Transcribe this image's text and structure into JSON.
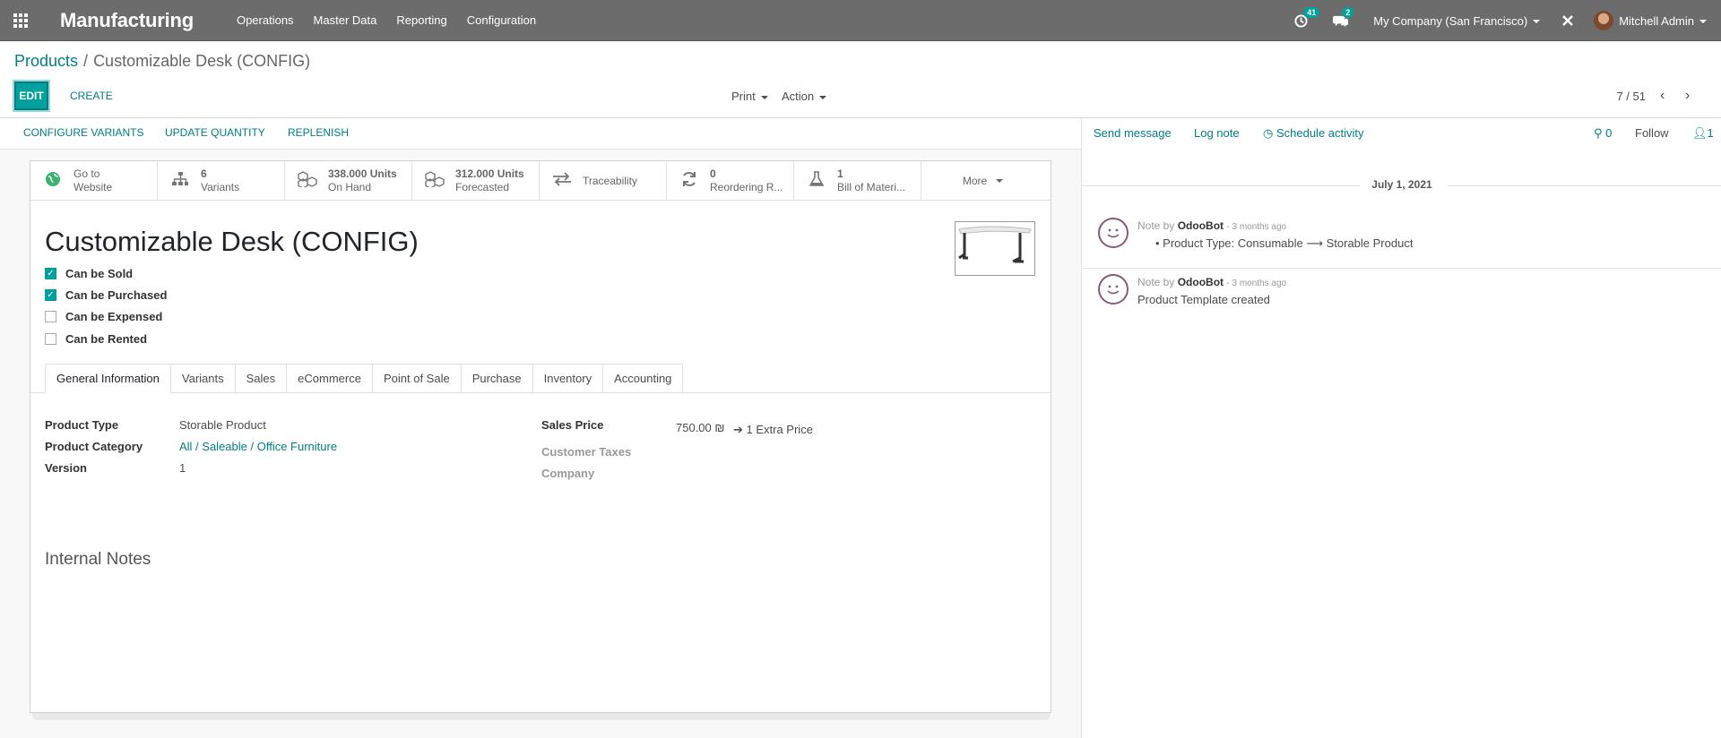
{
  "navbar": {
    "app_name": "Manufacturing",
    "menus": [
      "Operations",
      "Master Data",
      "Reporting",
      "Configuration"
    ],
    "activity_count": "41",
    "message_count": "2",
    "company": "My Company (San Francisco)",
    "user": "Mitchell Admin"
  },
  "breadcrumb": {
    "parent": "Products",
    "current": "Customizable Desk (CONFIG)"
  },
  "control": {
    "edit": "EDIT",
    "create": "CREATE",
    "print": "Print",
    "action": "Action",
    "pager": "7 / 51"
  },
  "statusbar": {
    "configure_variants": "CONFIGURE VARIANTS",
    "update_quantity": "UPDATE QUANTITY",
    "replenish": "REPLENISH"
  },
  "smart_buttons": [
    {
      "icon": "globe-icon",
      "value": "Go to",
      "label": "Website"
    },
    {
      "icon": "sitemap-icon",
      "value": "6",
      "label": "Variants"
    },
    {
      "icon": "cubes-icon",
      "value": "338.000 Units",
      "label": "On Hand"
    },
    {
      "icon": "cubes-icon",
      "value": "312.000 Units",
      "label": "Forecasted"
    },
    {
      "icon": "exchange-icon",
      "value": "",
      "label": "Traceability"
    },
    {
      "icon": "refresh-icon",
      "value": "0",
      "label": "Reordering R..."
    },
    {
      "icon": "flask-icon",
      "value": "1",
      "label": "Bill of Materi..."
    },
    {
      "icon": "",
      "value": "",
      "label": "More"
    }
  ],
  "product": {
    "name": "Customizable Desk (CONFIG)",
    "can_be_sold": "Can be Sold",
    "can_be_purchased": "Can be Purchased",
    "can_be_expensed": "Can be Expensed",
    "can_be_rented": "Can be Rented"
  },
  "tabs": [
    "General Information",
    "Variants",
    "Sales",
    "eCommerce",
    "Point of Sale",
    "Purchase",
    "Inventory",
    "Accounting"
  ],
  "general": {
    "product_type_label": "Product Type",
    "product_type": "Storable Product",
    "category_label": "Product Category",
    "category": "All / Saleable / Office Furniture",
    "version_label": "Version",
    "version": "1",
    "sales_price_label": "Sales Price",
    "sales_price": "750.00 ₪",
    "extra_price": "1 Extra Price",
    "customer_taxes_label": "Customer Taxes",
    "company_label": "Company",
    "internal_notes": "Internal Notes"
  },
  "chatter": {
    "send_message": "Send message",
    "log_note": "Log note",
    "schedule_activity": "Schedule activity",
    "attachments": "0",
    "follow": "Follow",
    "followers": "1",
    "date": "July 1, 2021",
    "messages": [
      {
        "prefix": "Note by",
        "author": "OdooBot",
        "time": "- 3 months ago",
        "body": "Product Type: Consumable ⟶ Storable Product"
      },
      {
        "prefix": "Note by",
        "author": "OdooBot",
        "time": "- 3 months ago",
        "body": "Product Template created"
      }
    ]
  }
}
